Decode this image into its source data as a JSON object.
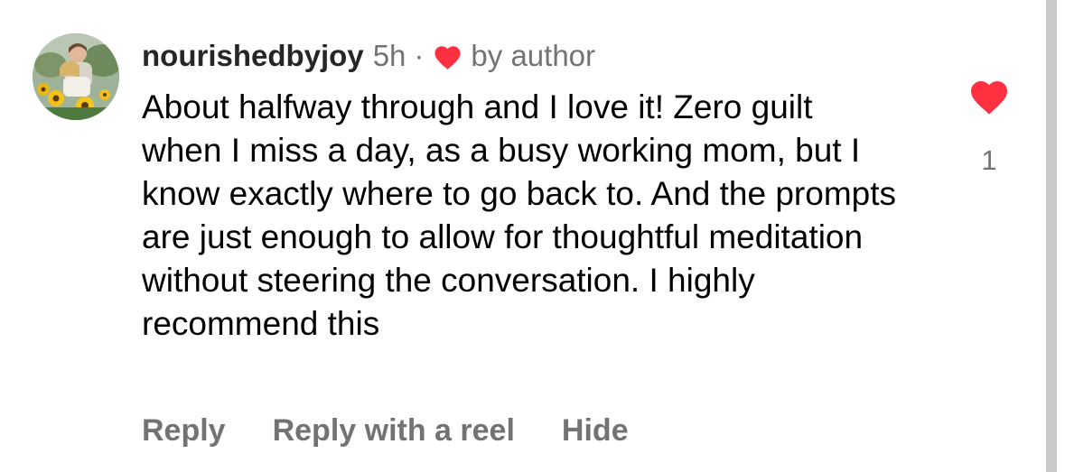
{
  "comment": {
    "username": "nourishedbyjoy",
    "time": "5h",
    "separator": "·",
    "author_like_label": "by author",
    "text": "About halfway through and I love it! Zero guilt when I miss a day, as a busy working mom, but I know exactly where to go back to. And the prompts are just enough to allow for thoughtful meditation without steering the conversation. I highly recommend this",
    "like_count": "1",
    "actions": {
      "reply": "Reply",
      "reply_with_reel": "Reply with a reel",
      "hide": "Hide"
    }
  },
  "icons": {
    "avatar": "profile-photo",
    "author_heart": "heart-icon",
    "like": "heart-filled-icon"
  },
  "colors": {
    "heart": "#ff3040",
    "text": "#000000",
    "secondary": "#737373",
    "username": "#262626"
  }
}
